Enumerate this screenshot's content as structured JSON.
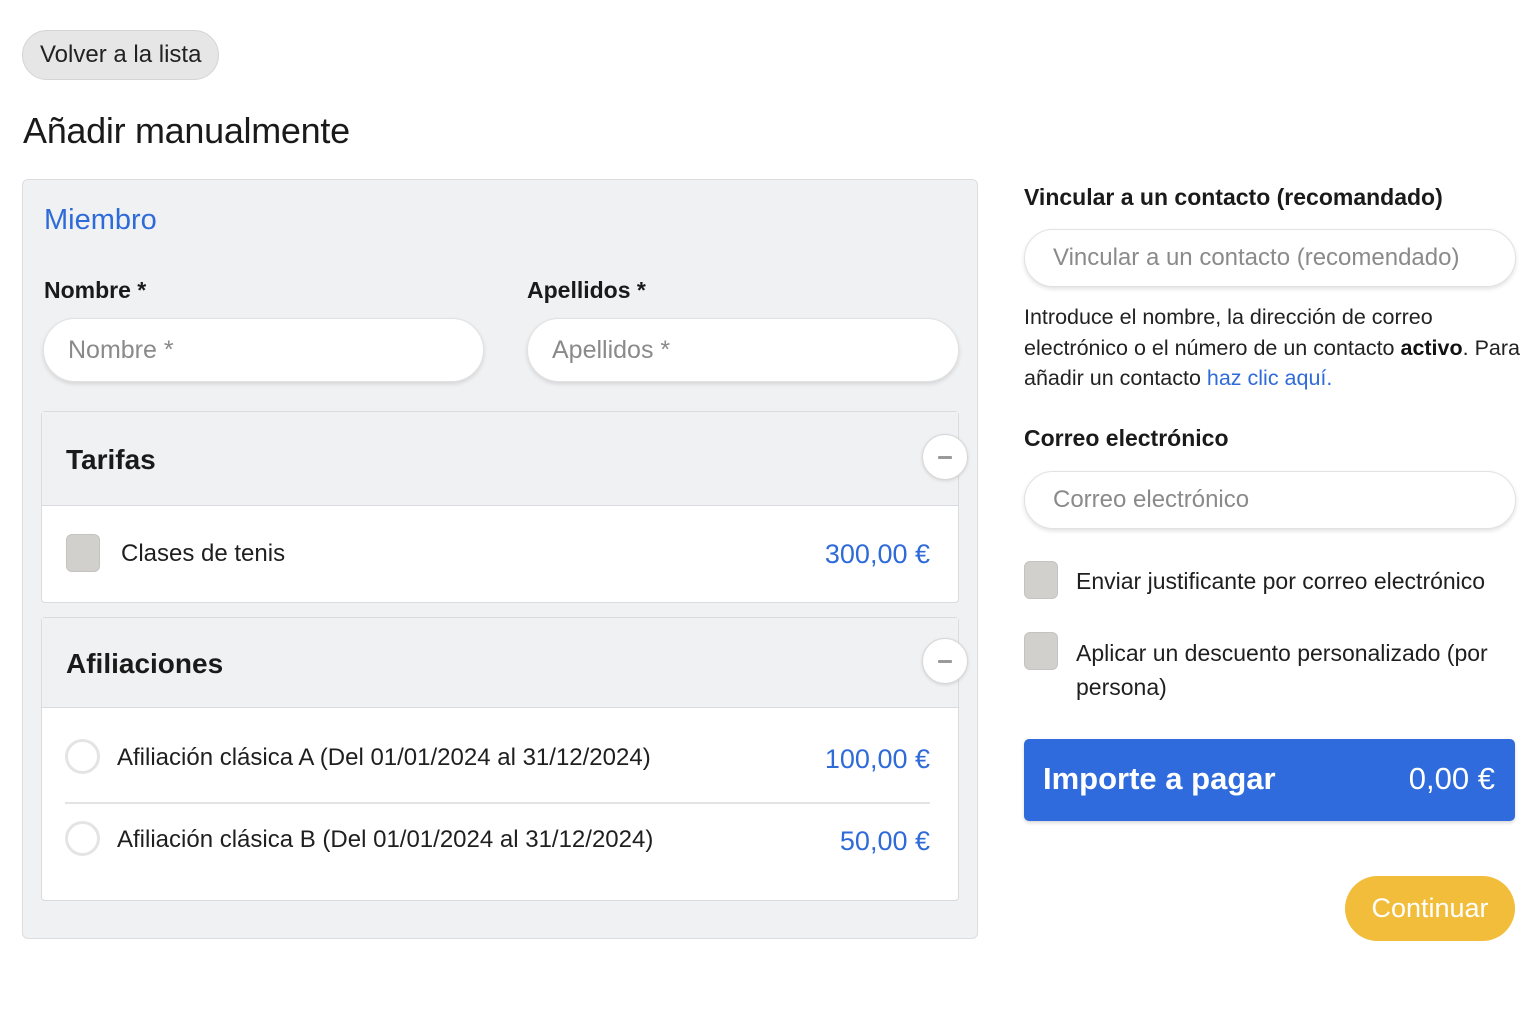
{
  "header": {
    "back_label": "Volver a la lista",
    "title": "Añadir manualmente"
  },
  "member": {
    "section_title": "Miembro",
    "first_name": {
      "label": "Nombre *",
      "placeholder": "Nombre *",
      "value": ""
    },
    "last_name": {
      "label": "Apellidos *",
      "placeholder": "Apellidos *",
      "value": ""
    }
  },
  "tarifas": {
    "title": "Tarifas",
    "items": [
      {
        "label": "Clases de tenis",
        "price": "300,00 €",
        "checked": false
      }
    ]
  },
  "afiliaciones": {
    "title": "Afiliaciones",
    "items": [
      {
        "label": "Afiliación clásica A (Del 01/01/2024 al 31/12/2024)",
        "price": "100,00 €",
        "selected": false
      },
      {
        "label": "Afiliación clásica B (Del 01/01/2024 al 31/12/2024)",
        "price": "50,00 €",
        "selected": false
      }
    ]
  },
  "contact": {
    "label": "Vincular a un contacto (recomandado)",
    "placeholder": "Vincular a un contacto (recomendado)",
    "help_before": "Introduce el nombre, la dirección de correo electrónico o el número de un contacto ",
    "help_bold": "activo",
    "help_middle": ". Para añadir un contacto ",
    "help_link": "haz clic aquí."
  },
  "email": {
    "label": "Correo electrónico",
    "placeholder": "Correo electrónico"
  },
  "options": {
    "send_receipt": "Enviar justificante por correo electrónico",
    "custom_discount": "Aplicar un descuento personalizado (por persona)"
  },
  "total": {
    "label": "Importe a pagar",
    "value": "0,00 €"
  },
  "continue_label": "Continuar",
  "colors": {
    "accent_blue": "#2f6bdc",
    "continue_yellow": "#f1bd3a",
    "card_background": "#f0f1f3"
  },
  "icons": [
    "minus-icon",
    "checkbox-icon",
    "radio-icon"
  ]
}
